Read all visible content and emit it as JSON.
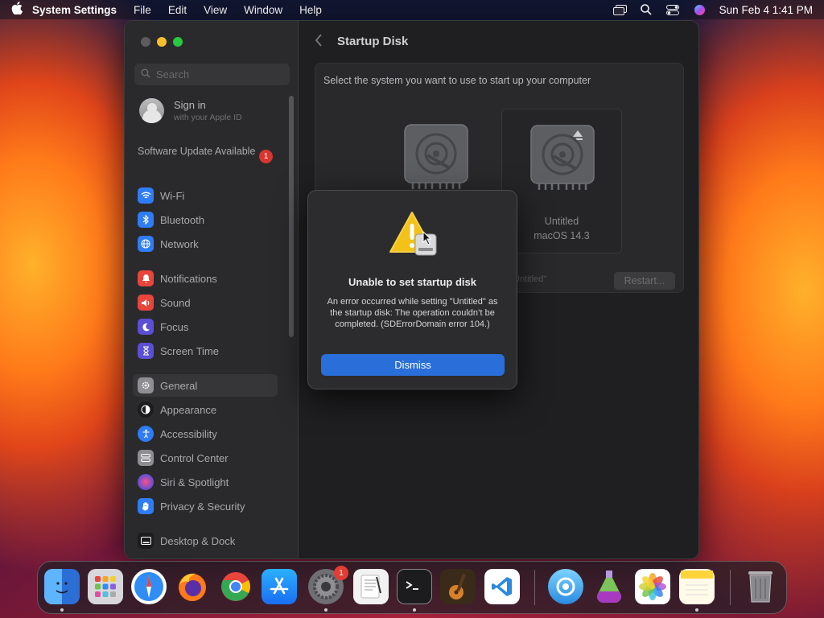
{
  "menubar": {
    "app_name": "System Settings",
    "menus": [
      "File",
      "Edit",
      "View",
      "Window",
      "Help"
    ],
    "datetime": "Sun Feb 4  1:41 PM"
  },
  "sidebar": {
    "search_placeholder": "Search",
    "account": {
      "name": "Sign in",
      "subtitle": "with your Apple ID"
    },
    "software_update": {
      "label": "Software Update Available",
      "badge": "1"
    },
    "items": [
      {
        "label": "Wi-Fi",
        "icon": "wifi-icon",
        "color": "#2f7cf6"
      },
      {
        "label": "Bluetooth",
        "icon": "bluetooth-icon",
        "color": "#2f7cf6"
      },
      {
        "label": "Network",
        "icon": "globe-icon",
        "color": "#2f7cf6"
      },
      {
        "label": "Notifications",
        "icon": "bell-icon",
        "color": "#e8453c"
      },
      {
        "label": "Sound",
        "icon": "speaker-icon",
        "color": "#e8453c"
      },
      {
        "label": "Focus",
        "icon": "moon-icon",
        "color": "#5b4fd6"
      },
      {
        "label": "Screen Time",
        "icon": "hourglass-icon",
        "color": "#5b4fd6"
      },
      {
        "label": "General",
        "icon": "gear-icon",
        "color": "#8e8e93"
      },
      {
        "label": "Appearance",
        "icon": "appearance-icon",
        "color": "#1c1c1e"
      },
      {
        "label": "Accessibility",
        "icon": "accessibility-icon",
        "color": "#2f7cf6"
      },
      {
        "label": "Control Center",
        "icon": "control-center-icon",
        "color": "#8e8e93"
      },
      {
        "label": "Siri & Spotlight",
        "icon": "siri-icon",
        "color": "#b04fd6"
      },
      {
        "label": "Privacy & Security",
        "icon": "hand-icon",
        "color": "#2f7cf6"
      },
      {
        "label": "Desktop & Dock",
        "icon": "dock-icon",
        "color": "#1c1c1e"
      }
    ],
    "selected": "General"
  },
  "main": {
    "title": "Startup Disk",
    "prompt": "Select the system you want to use to start up your computer",
    "disks": [
      {
        "name": "Untitled",
        "os": "macOS 14.3"
      }
    ],
    "status_fragment": "Untitled\"",
    "restart_label": "Restart..."
  },
  "dialog": {
    "title": "Unable to set startup disk",
    "message": "An error occurred while setting \"Untitled\" as the startup disk: The operation couldn’t be completed. (SDErrorDomain error 104.)",
    "button_label": "Dismiss"
  },
  "dock": {
    "apps": [
      {
        "name": "finder-icon",
        "color": "#3b8ef0"
      },
      {
        "name": "launchpad-icon",
        "color": "#d0d0d4"
      },
      {
        "name": "safari-icon",
        "color": "#2f8df5"
      },
      {
        "name": "firefox-icon",
        "color": "#ff7a1a"
      },
      {
        "name": "chrome-icon",
        "color": "#ffffff"
      },
      {
        "name": "app-store-icon",
        "color": "#1a8cf2"
      },
      {
        "name": "system-settings-icon",
        "color": "#6e6e73",
        "badge": "1"
      },
      {
        "name": "textedit-icon",
        "color": "#f2f2f2"
      },
      {
        "name": "terminal-icon",
        "color": "#1c1c1e"
      },
      {
        "name": "garageband-icon",
        "color": "#3a2a1a"
      },
      {
        "name": "vscode-icon",
        "color": "#ffffff"
      },
      {
        "name": "utility-icon",
        "color": "#4ab0e8"
      },
      {
        "name": "flask-app-icon",
        "color": "#7bc35a"
      },
      {
        "name": "photos-icon",
        "color": "#ffffff"
      },
      {
        "name": "notes-icon",
        "color": "#ffe26a"
      },
      {
        "name": "trash-icon",
        "color": "#8a8a8e"
      }
    ]
  }
}
